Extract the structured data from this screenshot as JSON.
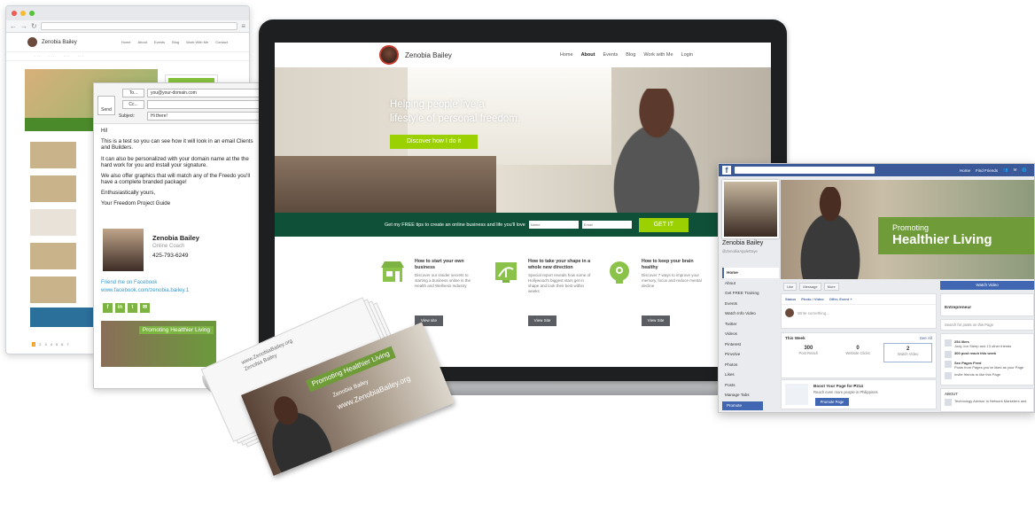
{
  "browser_back": {
    "site_name": "Zenobia Bailey",
    "nav": [
      "Home",
      "About",
      "Events",
      "Blog",
      "Work With Me",
      "Contact"
    ]
  },
  "email": {
    "send_label": "Send",
    "to_label": "To...",
    "cc_label": "Cc...",
    "subject_label": "Subject:",
    "to_value": "you@your-domain.com",
    "cc_value": "",
    "subject_value": "Hi there!",
    "greeting": "Hi!",
    "p1": "This is a test so you can see how it will look in an email Clients and Builders.",
    "p2": "It can also be personalized with your domain name at the the hard work for you and install your signature.",
    "p3": "We also offer graphics that will match any of the Freedo you'll have a complete branded package!",
    "closing": "Enthusiastically yours,",
    "signoff": "Your Freedom Project Guide",
    "sig_name": "Zenobia Bailey",
    "sig_title": "Online Coach",
    "sig_phone": "425-793-6249",
    "friend_text": "Friend me on Facebook",
    "fb_url": "www.facebook.com/zenobia.bailey.1",
    "banner": "Promoting Healthier Living"
  },
  "laptop_site": {
    "name": "Zenobia Bailey",
    "nav": [
      "Home",
      "About",
      "Events",
      "Blog",
      "Work with Me",
      "Login"
    ],
    "hero_line1": "Helping people live a",
    "hero_line2": "lifestyle of personal freedom.",
    "hero_button": "Discover how I do it",
    "optin_text": "Get my FREE tips to create an online business and life you'll love",
    "optin_name_placeholder": "Name",
    "optin_email_placeholder": "Email",
    "optin_button": "GET IT",
    "features": [
      {
        "title": "How to start your own business",
        "desc": "Discover our insider secrets to starting a business online in the Health and Wellness Industry",
        "button": "View site"
      },
      {
        "title": "How to take your shape in a whole new direction",
        "desc": "Special report reveals how some of Hollywood's biggest stars get in shape and look their best within weeks",
        "button": "View Site"
      },
      {
        "title": "How to keep your brain healthy",
        "desc": "Discover 7 ways to improve your memory, focus and reduce mental decline",
        "button": "View Site"
      }
    ]
  },
  "business_card": {
    "banner": "Promoting Healthier Living",
    "name": "Zenobia Bailey",
    "url": "www.ZenobiaBailey.org",
    "stack_line1": "www.ZenobiaBailey.org",
    "stack_line2": "Zenobia Bailey"
  },
  "facebook": {
    "top_links": [
      "Home",
      "Find Friends"
    ],
    "page_name": "Zenobia Bailey",
    "handle": "@ZenobiaAppleDaye",
    "cover_small": "Promoting",
    "cover_big": "Healthier Living",
    "menu": [
      "Home",
      "About",
      "Get FREE Training",
      "Events",
      "Watch Info Video",
      "Twitter",
      "Videos",
      "Pinterest",
      "Pinvolve",
      "Photos",
      "Likes",
      "Posts",
      "Manage Tabs"
    ],
    "promote": "Promote",
    "actions": [
      "Like",
      "Message",
      "More"
    ],
    "watch_button": "Watch Video",
    "post_tabs": [
      "Status",
      "Photo / Video",
      "Offer, Event +"
    ],
    "write_placeholder": "Write something...",
    "this_week": "This Week",
    "see_all": "See All",
    "stats": [
      {
        "num": "300",
        "label": "Post Reach"
      },
      {
        "num": "0",
        "label": "Website Clicks"
      },
      {
        "num": "2",
        "label": "Watch Video"
      }
    ],
    "boost_title": "Boost Your Page for ₱214",
    "boost_sub": "Reach even more people in Philippines",
    "boost_button": "Promote Page",
    "category": "Entrepreneur",
    "search_posts": "Search for posts on this Page",
    "likes_line": "254 likes",
    "likes_sub": "Jody Jon Steep and 13 other friends",
    "reach_line": "300 post reach this week",
    "feed_title": "See Pages Feed",
    "feed_sub": "Posts from Pages you've liked as your Page",
    "invite": "Invite friends to like this Page",
    "about": "ABOUT",
    "about_line": "Technology Advisor to Network Marketers and"
  }
}
